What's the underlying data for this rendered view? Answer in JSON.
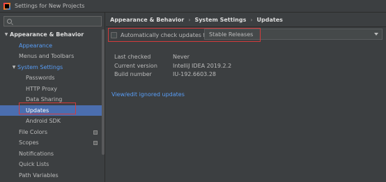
{
  "window": {
    "title": "Settings for New Projects"
  },
  "search": {
    "placeholder": "",
    "value": ""
  },
  "sidebar": {
    "items": [
      {
        "label": "Appearance & Behavior",
        "arrow": "▼"
      },
      {
        "label": "Appearance"
      },
      {
        "label": "Menus and Toolbars"
      },
      {
        "label": "System Settings",
        "arrow": "▼"
      },
      {
        "label": "Passwords"
      },
      {
        "label": "HTTP Proxy"
      },
      {
        "label": "Data Sharing"
      },
      {
        "label": "Updates"
      },
      {
        "label": "Android SDK"
      },
      {
        "label": "File Colors"
      },
      {
        "label": "Scopes"
      },
      {
        "label": "Notifications"
      },
      {
        "label": "Quick Lists"
      },
      {
        "label": "Path Variables"
      }
    ]
  },
  "breadcrumb": [
    "Appearance & Behavior",
    "System Settings",
    "Updates"
  ],
  "breadcrumb_separator": "›",
  "updates": {
    "auto_check_label": "Automatically check updates for",
    "channel_value": "Stable Releases",
    "info": [
      {
        "label": "Last checked",
        "value": "Never"
      },
      {
        "label": "Current version",
        "value": "IntelliJ IDEA 2019.2.2"
      },
      {
        "label": "Build number",
        "value": "IU-192.6603.28"
      }
    ],
    "ignored_link": "View/edit ignored updates"
  },
  "colors": {
    "background": "#3c3f41",
    "selection": "#4b6eaf",
    "link": "#589df6",
    "highlight_box": "#d43b3b"
  }
}
